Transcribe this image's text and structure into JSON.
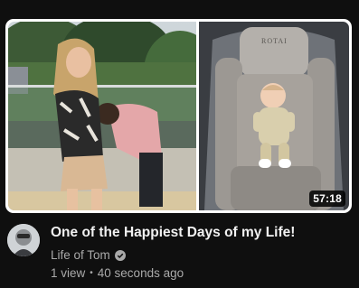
{
  "video": {
    "duration": "57:18",
    "title": "One of the Happiest Days of my Life!",
    "channel": "Life of Tom",
    "views": "1 view",
    "separator": "•",
    "age": "40 seconds ago"
  },
  "thumbnail": {
    "chair_brand": "ROTAI"
  },
  "icons": {
    "verified": "verified-check-icon"
  },
  "colors": {
    "background": "#0f0f0f",
    "primary_text": "#f1f1f1",
    "secondary_text": "#aaaaaa"
  }
}
